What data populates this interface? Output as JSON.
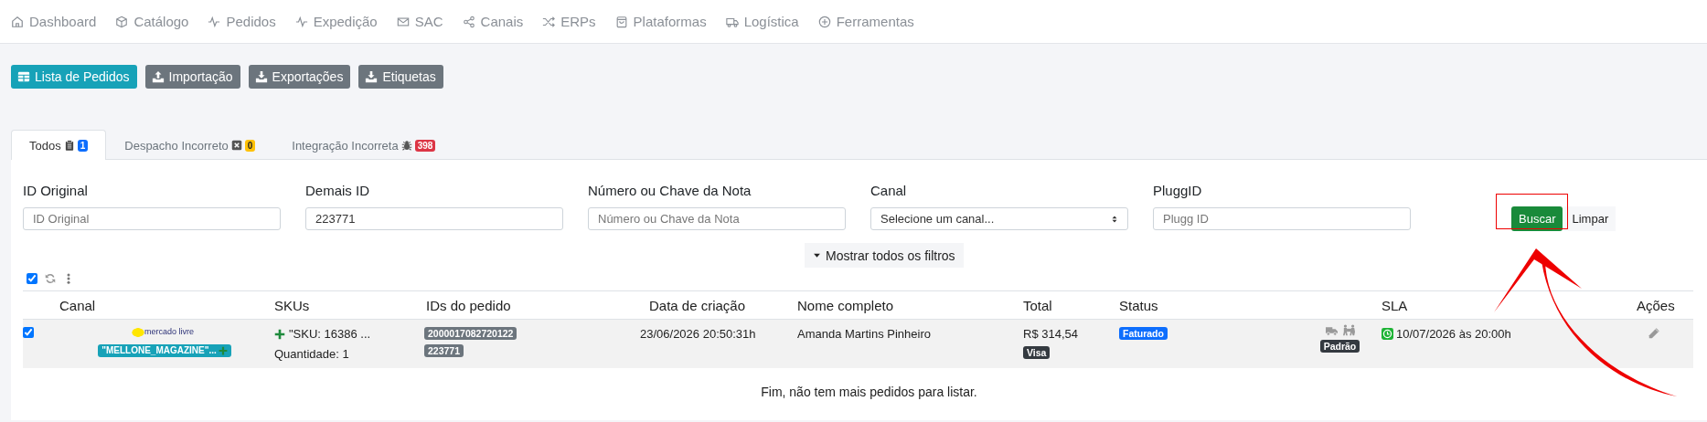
{
  "nav": [
    {
      "label": "Dashboard"
    },
    {
      "label": "Catálogo"
    },
    {
      "label": "Pedidos"
    },
    {
      "label": "Expedição"
    },
    {
      "label": "SAC"
    },
    {
      "label": "Canais"
    },
    {
      "label": "ERPs"
    },
    {
      "label": "Plataformas"
    },
    {
      "label": "Logística"
    },
    {
      "label": "Ferramentas"
    }
  ],
  "toolbar": [
    {
      "label": "Lista de Pedidos",
      "selected": true
    },
    {
      "label": "Importação",
      "selected": false
    },
    {
      "label": "Exportações",
      "selected": false
    },
    {
      "label": "Etiquetas",
      "selected": false
    }
  ],
  "tabs": [
    {
      "label": "Todos",
      "badge": "1",
      "color": "#0d6efd",
      "selected": true
    },
    {
      "label": "Despacho Incorreto",
      "badge": "0",
      "color": "#ffc107",
      "selected": false
    },
    {
      "label": "Integração Incorreta",
      "badge": "398",
      "color": "#dc3545",
      "selected": false
    }
  ],
  "filters": [
    {
      "kind": "text",
      "label": "ID Original",
      "placeholder": "ID Original"
    },
    {
      "kind": "text",
      "label": "Demais ID",
      "value": "223771"
    },
    {
      "kind": "text",
      "label": "Número ou Chave da Nota",
      "placeholder": "Número ou Chave da Nota"
    },
    {
      "kind": "select",
      "label": "Canal",
      "value": "Selecione um canal..."
    },
    {
      "kind": "text",
      "label": "PluggID",
      "placeholder": "Plugg ID"
    }
  ],
  "search_button": "Buscar",
  "clear_button": "Limpar",
  "show_filters_button": "Mostrar todos os filtros",
  "select_all": {
    "checked": true
  },
  "table": {
    "columns": [
      "Canal",
      "SKUs",
      "IDs do pedido",
      "Data de criação",
      "Nome completo",
      "Total",
      "Status",
      "SLA",
      "Ações"
    ],
    "rows": [
      {
        "checked": true,
        "channel_logo": "mercado livre",
        "channel_tag": "\"MELLONE_MAGAZINE\"...",
        "sku": "\"SKU: 16386 ...",
        "quantity": "Quantidade: 1",
        "ids": [
          "2000017082720122",
          "223771"
        ],
        "created": "23/06/2026 20:50:31h",
        "name": "Amanda Martins Pinheiro",
        "total": "R$ 314,54",
        "payment": "Visa",
        "status": "Faturado",
        "shipping": "Padrão",
        "sla": "10/07/2026 às 20:00h"
      }
    ]
  },
  "footer": "Fim, não tem mais pedidos para listar."
}
